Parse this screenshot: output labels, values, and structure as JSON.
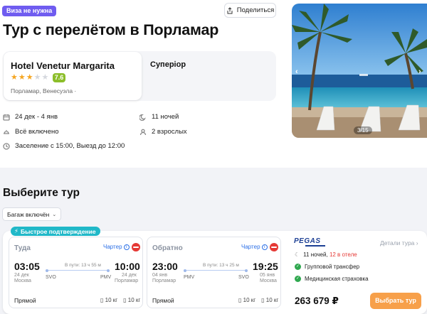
{
  "badge": {
    "visa": "Виза не нужна",
    "share": "Поделиться"
  },
  "page_title": "Тур с перелётом в Порламар",
  "hotel": {
    "name": "Hotel Venetur Margarita",
    "stars": 3,
    "max_stars": 5,
    "rating": "7.6",
    "location": "Порламар, Венесуэла",
    "room_type": "Суперіор"
  },
  "info": {
    "dates": "24 дек - 4 янв",
    "nights": "11 ночей",
    "meal": "Всё включено",
    "guests": "2 взрослых",
    "checkin": "Заселение с 15:00, Выезд до 12:00"
  },
  "gallery": {
    "counter": "3/15",
    "prev": "‹",
    "next": "›"
  },
  "tours": {
    "heading": "Выберите тур",
    "filter": "Багаж включён",
    "fast_badge": "Быстрое подтверждение",
    "outbound": {
      "title": "Туда",
      "charter": "Чартер",
      "dep_time": "03:05",
      "dep_date": "24 дек",
      "dep_city": "Москва",
      "arr_time": "10:00",
      "arr_date": "24 дек",
      "arr_city": "Порламар",
      "duration": "В пути: 13 ч 55 м",
      "from_code": "SVO",
      "to_code": "PMV",
      "direct": "Прямой",
      "bag1": "10 кг",
      "bag2": "10 кг"
    },
    "inbound": {
      "title": "Обратно",
      "charter": "Чартер",
      "dep_time": "23:00",
      "dep_date": "04 янв",
      "dep_city": "Порламар",
      "arr_time": "19:25",
      "arr_date": "05 янв",
      "arr_city": "Москва",
      "duration": "В пути: 13 ч 25 м",
      "from_code": "PMV",
      "to_code": "SVO",
      "direct": "Прямой",
      "bag1": "10 кг",
      "bag2": "10 кг"
    },
    "operator": "PEGAS",
    "details": "Детали тура",
    "nights_a": "11 ночей,",
    "nights_b": "12 в отеле",
    "transfer": "Групповой трансфер",
    "insurance": "Медицинская страховка",
    "price": "263 679 ₽",
    "buy": "Выбрать тур"
  },
  "colors": {
    "accent": "#6f5cf0",
    "buy": "#f7a04a",
    "rating": "#8cbe2a",
    "fast": "#20b8c8",
    "check": "#2fa84f"
  }
}
